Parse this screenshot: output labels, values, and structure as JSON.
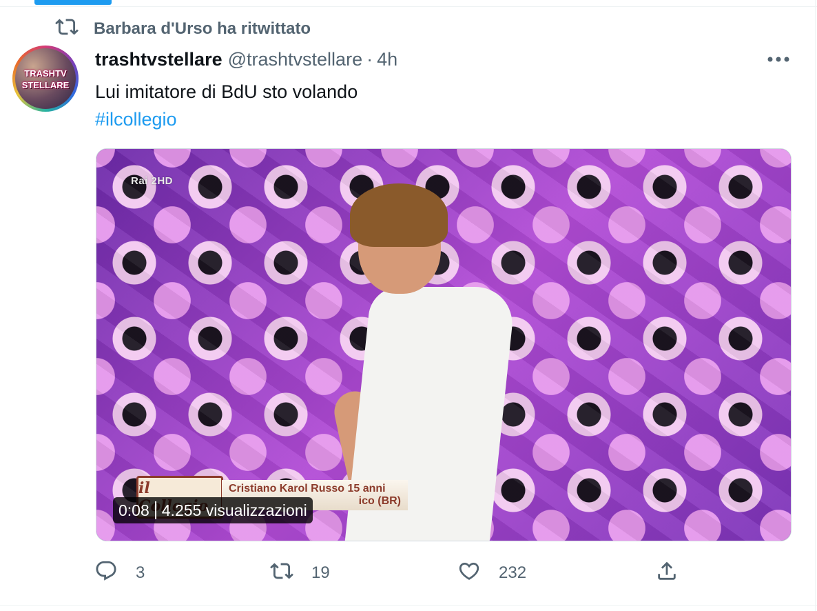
{
  "retweet_context": {
    "text": "Barbara d'Urso ha ritwittato",
    "icon": "retweet-icon"
  },
  "tweet": {
    "author_name": "trashtvstellare",
    "author_handle": "@trashtvstellare",
    "separator": "·",
    "time": "4h",
    "text": "Lui imitatore di BdU sto volando",
    "hashtag": "#ilcollegio",
    "avatar_text_line1": "TRASHTV",
    "avatar_text_line2": "STELLARE"
  },
  "media": {
    "type": "video",
    "duration": "0:08",
    "views": "4.255 visualizzazioni",
    "channel_logo": "Rai 2HD",
    "lower_third_logo": "il Collegio",
    "lower_third_line1": "Cristiano Karol Russo 15 anni",
    "lower_third_line2": "ico (BR)"
  },
  "actions": {
    "reply_count": "3",
    "retweet_count": "19",
    "like_count": "232"
  },
  "colors": {
    "accent": "#1d9bf0",
    "secondary_text": "#536471",
    "primary_text": "#0f1419"
  }
}
